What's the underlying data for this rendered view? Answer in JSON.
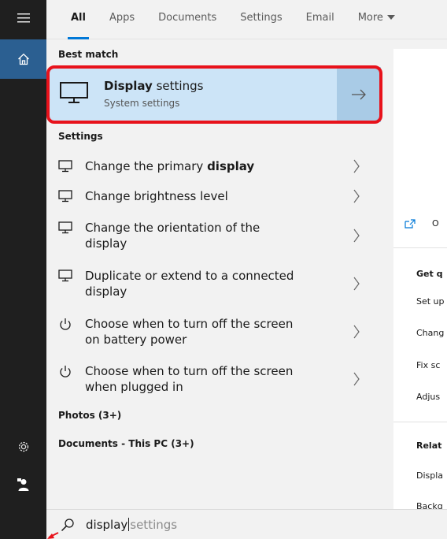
{
  "tabs": [
    {
      "label": "All",
      "active": true
    },
    {
      "label": "Apps"
    },
    {
      "label": "Documents"
    },
    {
      "label": "Settings"
    },
    {
      "label": "Email"
    },
    {
      "label": "More"
    }
  ],
  "rail": {
    "icons": [
      "hamburger-menu-icon",
      "home-icon",
      "gear-icon",
      "user-icon"
    ],
    "active_color": "#2b5f91"
  },
  "results": {
    "best_match_heading": "Best match",
    "best_match": {
      "title_bold": "Display",
      "title_rest": " settings",
      "subtitle": "System settings",
      "icon": "monitor-icon",
      "highlight_color": "#cce4f7",
      "outline_color": "#e8121b"
    },
    "settings_heading": "Settings",
    "settings_items": [
      {
        "line1": "Change the primary ",
        "line1_bold": "display",
        "line2": "",
        "icon": "monitor-icon"
      },
      {
        "line1": "Change brightness level",
        "line1_bold": "",
        "line2": "",
        "icon": "monitor-icon"
      },
      {
        "line1": "Change the orientation of the",
        "line1_bold": "",
        "line2": "display",
        "icon": "monitor-icon"
      },
      {
        "line1": "Duplicate or extend to a connected",
        "line1_bold": "",
        "line2": "display",
        "icon": "monitor-icon"
      },
      {
        "line1": "Choose when to turn off the screen",
        "line1_bold": "",
        "line2": "on battery power",
        "icon": "power-icon"
      },
      {
        "line1": "Choose when to turn off the screen",
        "line1_bold": "",
        "line2": "when plugged in",
        "icon": "power-icon"
      }
    ],
    "photos_heading": "Photos (3+)",
    "documents_heading": "Documents - This PC (3+)"
  },
  "preview": {
    "open_label": "O",
    "get_quick_heading": "Get q",
    "quick_links": [
      "Set up",
      "Chang",
      "Fix sc",
      "Adjus"
    ],
    "related_heading": "Relat",
    "related_links": [
      "Displa",
      "Backg"
    ]
  },
  "search": {
    "typed": "display",
    "suggestion": "settings"
  }
}
